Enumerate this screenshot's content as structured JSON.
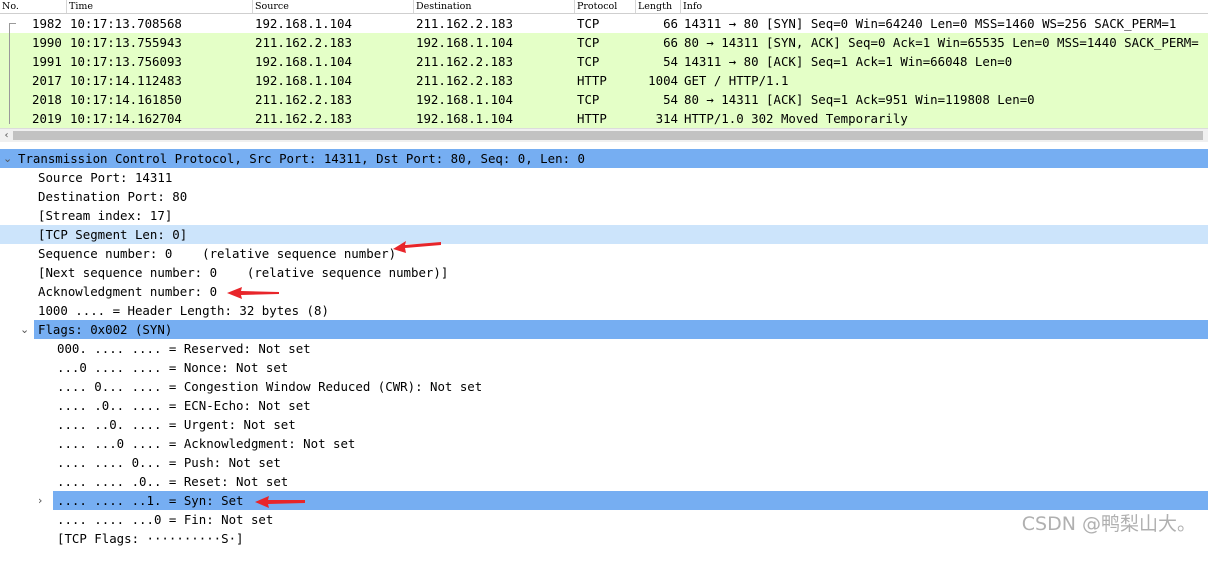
{
  "columns": {
    "no": "No.",
    "time": "Time",
    "source": "Source",
    "destination": "Destination",
    "protocol": "Protocol",
    "length": "Length",
    "info": "Info"
  },
  "packets": [
    {
      "no": "1982",
      "time": "10:17:13.708568",
      "source": "192.168.1.104",
      "destination": "211.162.2.183",
      "protocol": "TCP",
      "length": "66",
      "info": "14311 → 80 [SYN] Seq=0 Win=64240 Len=0 MSS=1460 WS=256 SACK_PERM=1"
    },
    {
      "no": "1990",
      "time": "10:17:13.755943",
      "source": "211.162.2.183",
      "destination": "192.168.1.104",
      "protocol": "TCP",
      "length": "66",
      "info": "80 → 14311 [SYN, ACK] Seq=0 Ack=1 Win=65535 Len=0 MSS=1440 SACK_PERM="
    },
    {
      "no": "1991",
      "time": "10:17:13.756093",
      "source": "192.168.1.104",
      "destination": "211.162.2.183",
      "protocol": "TCP",
      "length": "54",
      "info": "14311 → 80 [ACK] Seq=1 Ack=1 Win=66048 Len=0"
    },
    {
      "no": "2017",
      "time": "10:17:14.112483",
      "source": "192.168.1.104",
      "destination": "211.162.2.183",
      "protocol": "HTTP",
      "length": "1004",
      "info": "GET / HTTP/1.1"
    },
    {
      "no": "2018",
      "time": "10:17:14.161850",
      "source": "211.162.2.183",
      "destination": "192.168.1.104",
      "protocol": "TCP",
      "length": "54",
      "info": "80 → 14311 [ACK] Seq=1 Ack=951 Win=119808 Len=0"
    },
    {
      "no": "2019",
      "time": "10:17:14.162704",
      "source": "211.162.2.183",
      "destination": "192.168.1.104",
      "protocol": "HTTP",
      "length": "314",
      "info": "HTTP/1.0 302 Moved Temporarily"
    }
  ],
  "scroll_left_icon": "‹",
  "details": {
    "tcp_header": "Transmission Control Protocol, Src Port: 14311, Dst Port: 80, Seq: 0, Len: 0",
    "src_port": "Source Port: 14311",
    "dst_port": "Destination Port: 80",
    "stream_index": "[Stream index: 17]",
    "segment_len": "[TCP Segment Len: 0]",
    "seq_number": "Sequence number: 0    (relative sequence number)",
    "next_seq": "[Next sequence number: 0    (relative sequence number)]",
    "ack_number": "Acknowledgment number: 0",
    "header_length": "1000 .... = Header Length: 32 bytes (8)",
    "flags_header": "Flags: 0x002 (SYN)",
    "flag_reserved": "000. .... .... = Reserved: Not set",
    "flag_nonce": "...0 .... .... = Nonce: Not set",
    "flag_cwr": ".... 0... .... = Congestion Window Reduced (CWR): Not set",
    "flag_ecn": ".... .0.. .... = ECN-Echo: Not set",
    "flag_urgent": ".... ..0. .... = Urgent: Not set",
    "flag_ack": ".... ...0 .... = Acknowledgment: Not set",
    "flag_push": ".... .... 0... = Push: Not set",
    "flag_reset": ".... .... .0.. = Reset: Not set",
    "flag_syn": ".... .... ..1. = Syn: Set",
    "flag_fin": ".... .... ...0 = Fin: Not set",
    "tcp_flags": "[TCP Flags: ··········S·]"
  },
  "icons": {
    "expanded": "chevron-down-icon",
    "collapsed": "chevron-right-icon",
    "annotation": "red-arrow-icon"
  },
  "colors": {
    "packet_bg": "#e4ffc7",
    "selected_bg": "#76aef2",
    "hover_bg": "#cce4fb",
    "arrow": "#e8252a"
  },
  "watermark": "CSDN @鸭梨山大。"
}
